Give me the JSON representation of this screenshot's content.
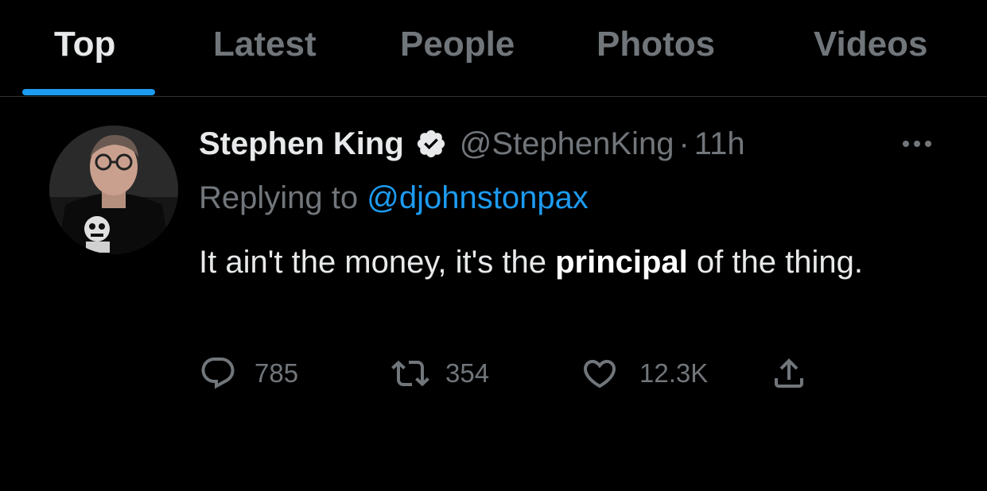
{
  "tabs": [
    {
      "label": "Top",
      "active": true
    },
    {
      "label": "Latest",
      "active": false
    },
    {
      "label": "People",
      "active": false
    },
    {
      "label": "Photos",
      "active": false
    },
    {
      "label": "Videos",
      "active": false
    }
  ],
  "tweet": {
    "display_name": "Stephen King",
    "verified": true,
    "handle": "@StephenKing",
    "separator": "·",
    "timestamp": "11h",
    "replying_prefix": "Replying to",
    "replying_to": "@djohnstonpax",
    "text_before": "It ain't the money, it's the ",
    "text_bold": "principal",
    "text_after": " of the thing.",
    "actions": {
      "replies": "785",
      "retweets": "354",
      "likes": "12.3K"
    }
  },
  "colors": {
    "background": "#000000",
    "accent": "#1d9bf0",
    "text_primary": "#e7e9ea",
    "text_secondary": "#71767b",
    "divider": "#2f3336"
  },
  "icons": {
    "verified": "verified-badge-icon",
    "more": "more-dots-icon",
    "reply": "reply-bubble-icon",
    "retweet": "retweet-icon",
    "like": "heart-icon",
    "share": "share-icon"
  }
}
